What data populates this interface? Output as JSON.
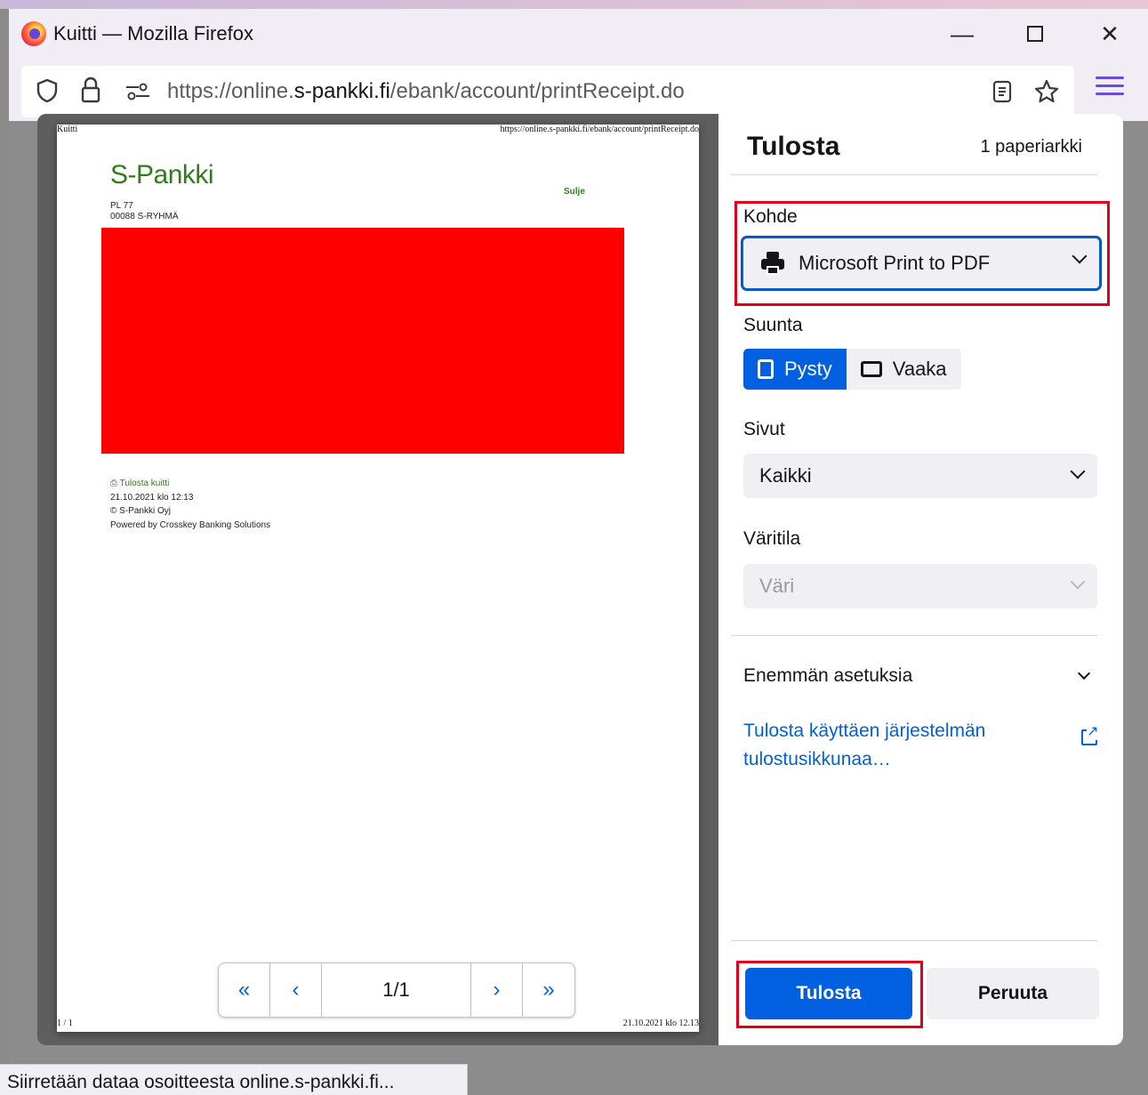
{
  "window": {
    "title": "Kuitti — Mozilla Firefox",
    "min_glyph": "—",
    "close_glyph": "✕"
  },
  "navbar": {
    "url_prefix": "https://online.",
    "url_domain": "s-pankki.fi",
    "url_path": "/ebank/account/printReceipt.do"
  },
  "preview": {
    "header_left": "Kuitti",
    "header_right": "https://online.s-pankki.fi/ebank/account/printReceipt.do",
    "logo": "S-Pankki",
    "sulje": "Sulje",
    "address_line1": "PL 77",
    "address_line2": "00088 S-RYHMÄ",
    "redacted_color": "#ff0000",
    "print_link": "Tulosta kuitti",
    "date": "21.10.2021 klo 12:13",
    "copyright": "© S-Pankki Oyj",
    "powered": "Powered by Crosskey Banking Solutions",
    "footer_left": "1 / 1",
    "footer_right": "21.10.2021 klo 12.13",
    "pager": {
      "first": "«",
      "prev": "‹",
      "page": "1/1",
      "next": "›",
      "last": "»"
    }
  },
  "settings": {
    "title": "Tulosta",
    "sheets": "1 paperiarkki",
    "destination_label": "Kohde",
    "destination_value": "Microsoft Print to PDF",
    "orientation_label": "Suunta",
    "portrait": "Pysty",
    "landscape": "Vaaka",
    "pages_label": "Sivut",
    "pages_value": "Kaikki",
    "color_label": "Väritila",
    "color_value": "Väri",
    "more_settings": "Enemmän asetuksia",
    "system_dialog_link": "Tulosta käyttäen järjestelmän tulostusikkunaa…",
    "print_button": "Tulosta",
    "cancel_button": "Peruuta"
  },
  "statusbar": {
    "text": "Siirretään dataa osoitteesta online.s-pankki.fi..."
  },
  "colors": {
    "accent": "#0060df",
    "highlight_box": "#e0001b",
    "bank_green": "#2e7d1a"
  }
}
